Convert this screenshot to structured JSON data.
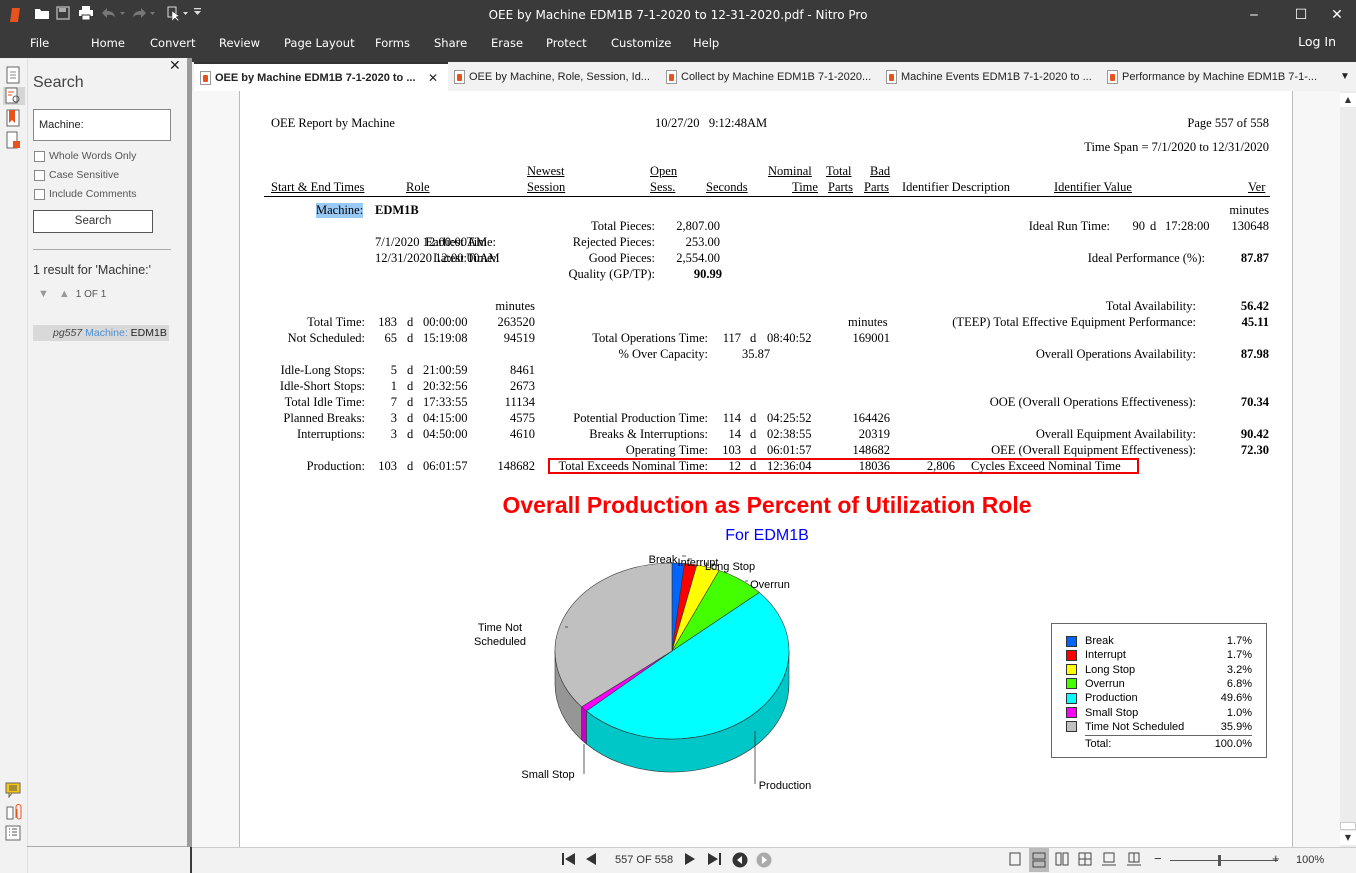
{
  "app": {
    "title": "OEE by Machine EDM1B 7-1-2020 to 12-31-2020.pdf - Nitro Pro",
    "window_controls": {
      "minimize": "‒",
      "maximize": "☐",
      "close": "✕"
    }
  },
  "quick_access": [
    "open-icon",
    "save-icon",
    "print-icon",
    "undo-icon",
    "redo-icon",
    "select-icon",
    "customize-icon"
  ],
  "menu": [
    "File",
    "Home",
    "Convert",
    "Review",
    "Page Layout",
    "Forms",
    "Share",
    "Erase",
    "Protect",
    "Customize",
    "Help"
  ],
  "login": "Log In",
  "left_strip_icons": [
    "pages-icon",
    "search-panel-icon",
    "bookmarks-icon",
    "security-icon",
    "comments-icon",
    "attachments-icon",
    "output-icon"
  ],
  "search_panel": {
    "title": "Search",
    "close": "✕",
    "query": "Machine:",
    "options": [
      "Whole Words Only",
      "Case Sensitive",
      "Include Comments"
    ],
    "button": "Search",
    "result_count": "1 result for 'Machine:'",
    "result_nav": "1 OF 1",
    "result": {
      "page": "pg557",
      "match": "Machine:",
      "rest": "EDM1B"
    }
  },
  "tabs": [
    {
      "label": "OEE by Machine EDM1B 7-1-2020 to ...",
      "active": true
    },
    {
      "label": "OEE by Machine, Role, Session, Id...",
      "active": false
    },
    {
      "label": "Collect by Machine EDM1B 7-1-2020...",
      "active": false
    },
    {
      "label": "Machine Events EDM1B 7-1-2020 to ...",
      "active": false
    },
    {
      "label": "Performance by Machine EDM1B 7-1-...",
      "active": false
    }
  ],
  "report": {
    "title": "OEE Report by Machine",
    "datetime": "10/27/20   9:12:48AM",
    "page": "Page 557 of 558",
    "timespan": "Time Span = 7/1/2020 to 12/31/2020",
    "columns": [
      "Start & End Times",
      "Role",
      "Newest",
      "Session",
      "Open",
      "Sess.",
      "Seconds",
      "Nominal",
      "Time",
      "Total",
      "Parts",
      "Bad",
      "Parts",
      "Identifier Description",
      "Identifier Value",
      "Ver"
    ],
    "machine_label": "Machine:",
    "machine": "EDM1B",
    "earliest_label": "Earliest Time:",
    "earliest": "7/1/2020  12:00:00AM",
    "latest_label": "Latest Time:",
    "latest": "12/31/2020  12:00:00AM",
    "pieces": [
      {
        "label": "Total Pieces:",
        "value": "2,807.00"
      },
      {
        "label": "Rejected Pieces:",
        "value": "253.00"
      },
      {
        "label": "Good Pieces:",
        "value": "2,554.00"
      },
      {
        "label": "Quality (GP/TP):",
        "value": "90.99"
      }
    ],
    "minutes_label": "minutes",
    "ideal_run": {
      "label": "Ideal Run Time:",
      "d": "90",
      "unit": "d",
      "time": "17:28:00",
      "minutes": "130648"
    },
    "ideal_perf": {
      "label": "Ideal Performance (%):",
      "value": "87.87"
    },
    "times_left": [
      {
        "label": "Total Time:",
        "d": "183",
        "time": "00:00:00",
        "min": "263520"
      },
      {
        "label": "Not Scheduled:",
        "d": "65",
        "time": "15:19:08",
        "min": "94519"
      },
      {
        "label": "Idle-Long Stops:",
        "d": "5",
        "time": "21:00:59",
        "min": "8461"
      },
      {
        "label": "Idle-Short Stops:",
        "d": "1",
        "time": "20:32:56",
        "min": "2673"
      },
      {
        "label": "Total Idle Time:",
        "d": "7",
        "time": "17:33:55",
        "min": "11134"
      },
      {
        "label": "Planned Breaks:",
        "d": "3",
        "time": "04:15:00",
        "min": "4575"
      },
      {
        "label": "Interruptions:",
        "d": "3",
        "time": "04:50:00",
        "min": "4610"
      },
      {
        "label": "Production:",
        "d": "103",
        "time": "06:01:57",
        "min": "148682"
      }
    ],
    "times_mid": [
      {
        "label": "Total Operations Time:",
        "d": "117",
        "time": "08:40:52",
        "min": "169001"
      },
      {
        "label": "% Over Capacity:",
        "value": "35.87"
      },
      {
        "label": "Potential Production Time:",
        "d": "114",
        "time": "04:25:52",
        "min": "164426"
      },
      {
        "label": "Breaks & Interruptions:",
        "d": "14",
        "time": "02:38:55",
        "min": "20319"
      },
      {
        "label": "Operating Time:",
        "d": "103",
        "time": "06:01:57",
        "min": "148682"
      },
      {
        "label": "Total Exceeds Nominal Time:",
        "d": "12",
        "time": "12:36:04",
        "min": "18036"
      }
    ],
    "cycles_exceed": {
      "count": "2,806",
      "label": "Cycles Exceed Nominal Time"
    },
    "metrics": [
      {
        "label": "Total Availability:",
        "value": "56.42"
      },
      {
        "label": "(TEEP) Total Effective Equipment Performance:",
        "value": "45.11"
      },
      {
        "label": "Overall Operations Availability:",
        "value": "87.98"
      },
      {
        "label": "OOE (Overall Operations Effectiveness):",
        "value": "70.34"
      },
      {
        "label": "Overall Equipment Availability:",
        "value": "90.42"
      },
      {
        "label": "OEE (Overall Equipment Effectiveness):",
        "value": "72.30"
      }
    ]
  },
  "chart_data": {
    "type": "pie",
    "title": "Overall Production as Percent of Utilization Role",
    "subtitle": "For EDM1B",
    "categories": [
      "Break",
      "Interrupt",
      "Long Stop",
      "Overrun",
      "Production",
      "Small Stop",
      "Time Not Scheduled"
    ],
    "values": [
      1.7,
      1.7,
      3.2,
      6.8,
      49.6,
      1.0,
      35.9
    ],
    "labels": [
      "1.7%",
      "1.7%",
      "3.2%",
      "6.8%",
      "49.6%",
      "1.0%",
      "35.9%"
    ],
    "colors": [
      "#0064ff",
      "#ff0000",
      "#ffff00",
      "#44ff00",
      "#00ffff",
      "#ff00ff",
      "#c0c0c0"
    ],
    "slice_labels": [
      "Break",
      "Interrupt",
      "Long Stop",
      "Overrun",
      "Production",
      "Small Stop",
      "Time Not Scheduled"
    ],
    "legend_position": "right",
    "total_label": "Total:",
    "total": "100.0%"
  },
  "status_bar": {
    "page_indicator": "557 OF 558",
    "zoom": "100%"
  }
}
